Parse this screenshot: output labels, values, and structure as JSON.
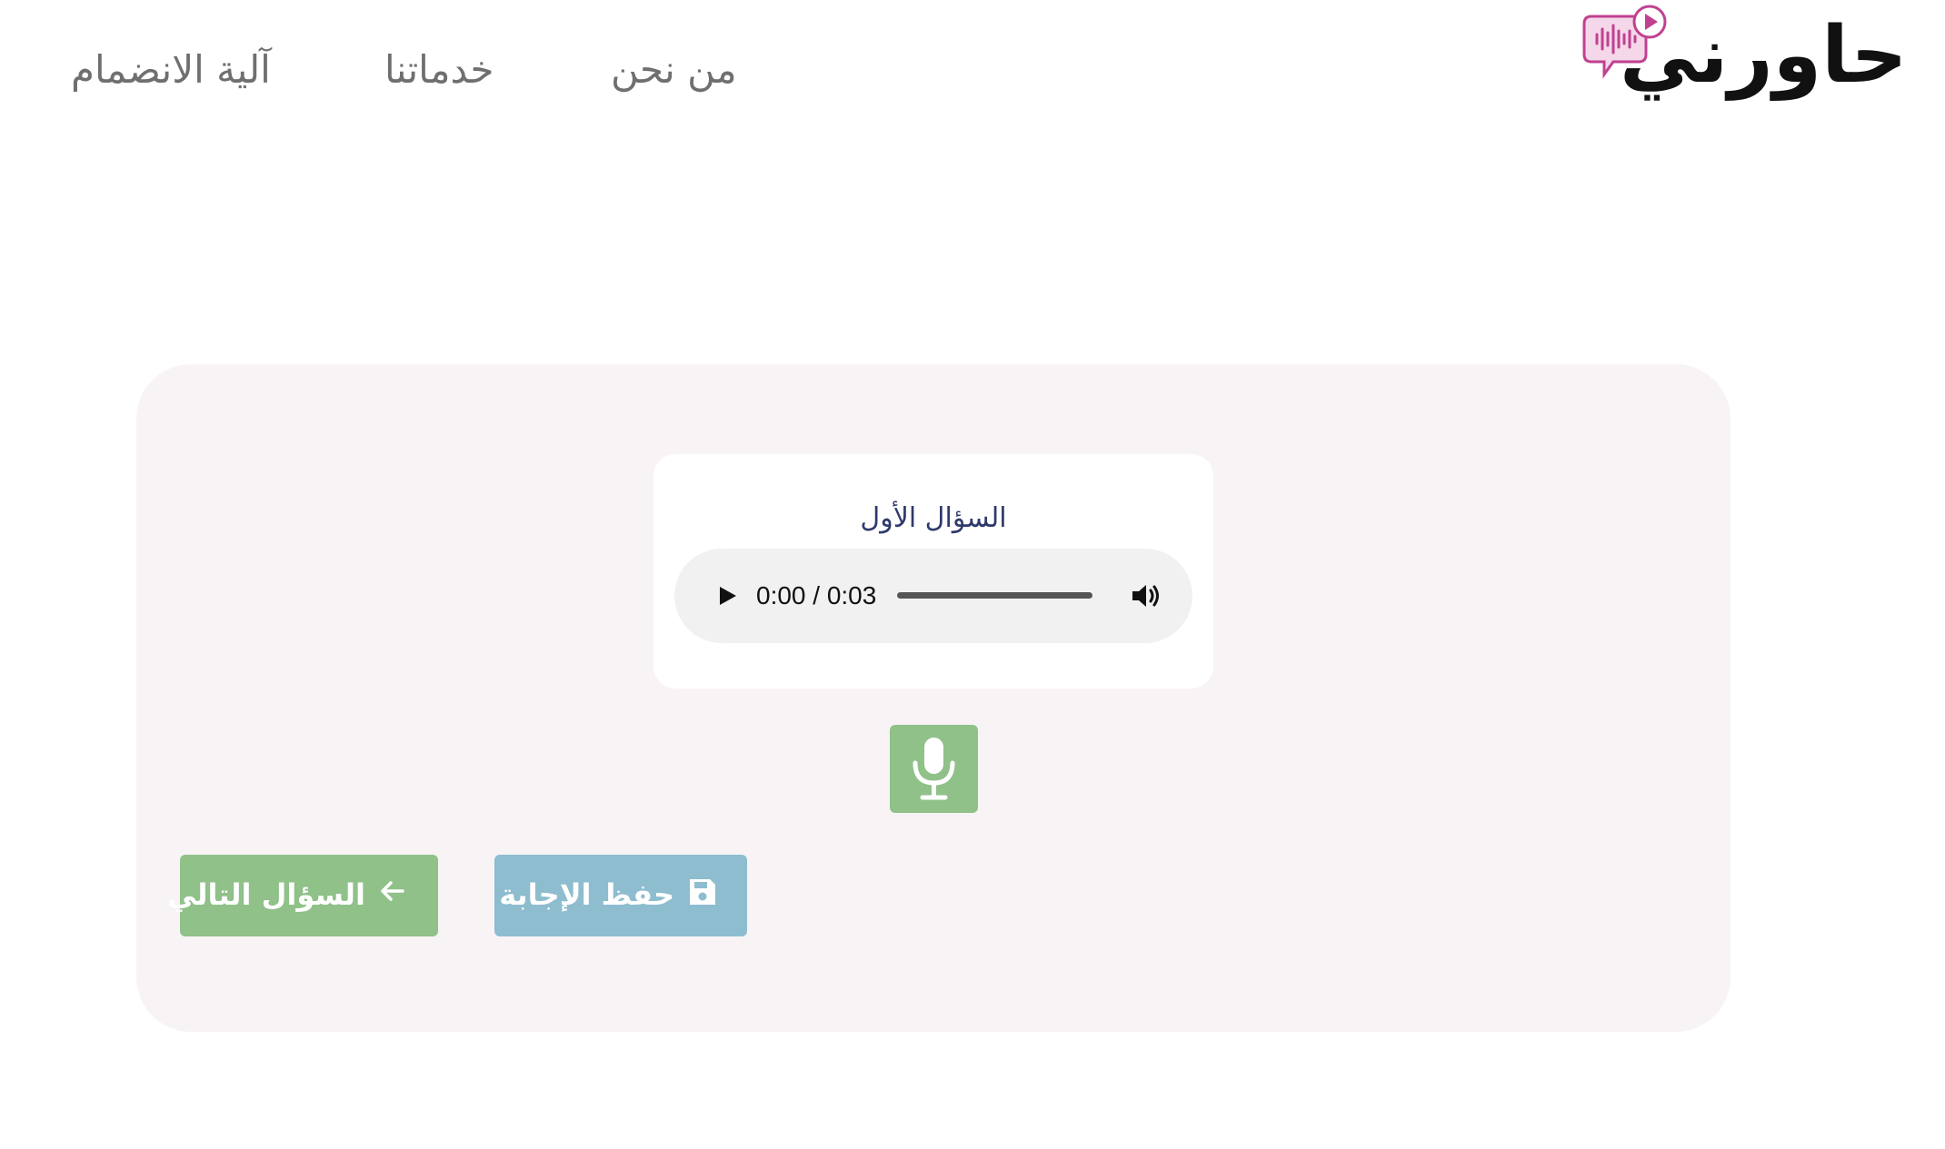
{
  "header": {
    "logo_text": "حاورني",
    "nav": {
      "about": "من نحن",
      "services": "خدماتنا",
      "join": "آلية الانضمام"
    }
  },
  "question": {
    "title": "السؤال الأول",
    "audio": {
      "time": "0:00 / 0:03",
      "progress": 0
    }
  },
  "actions": {
    "save_label": "حفظ الإجابة",
    "next_label": "السؤال التالي"
  },
  "colors": {
    "accent_green": "#8fc189",
    "accent_blue": "#8dbdcf",
    "card_bg": "#f8f4f6",
    "logo_pink": "#c0418f",
    "title_navy": "#2e3a6b"
  },
  "icons": {
    "logo": "speech-bubble-soundwave-icon",
    "play": "play-icon",
    "volume": "volume-icon",
    "mic": "microphone-icon",
    "save": "floppy-disk-icon",
    "next": "arrow-left-icon"
  }
}
